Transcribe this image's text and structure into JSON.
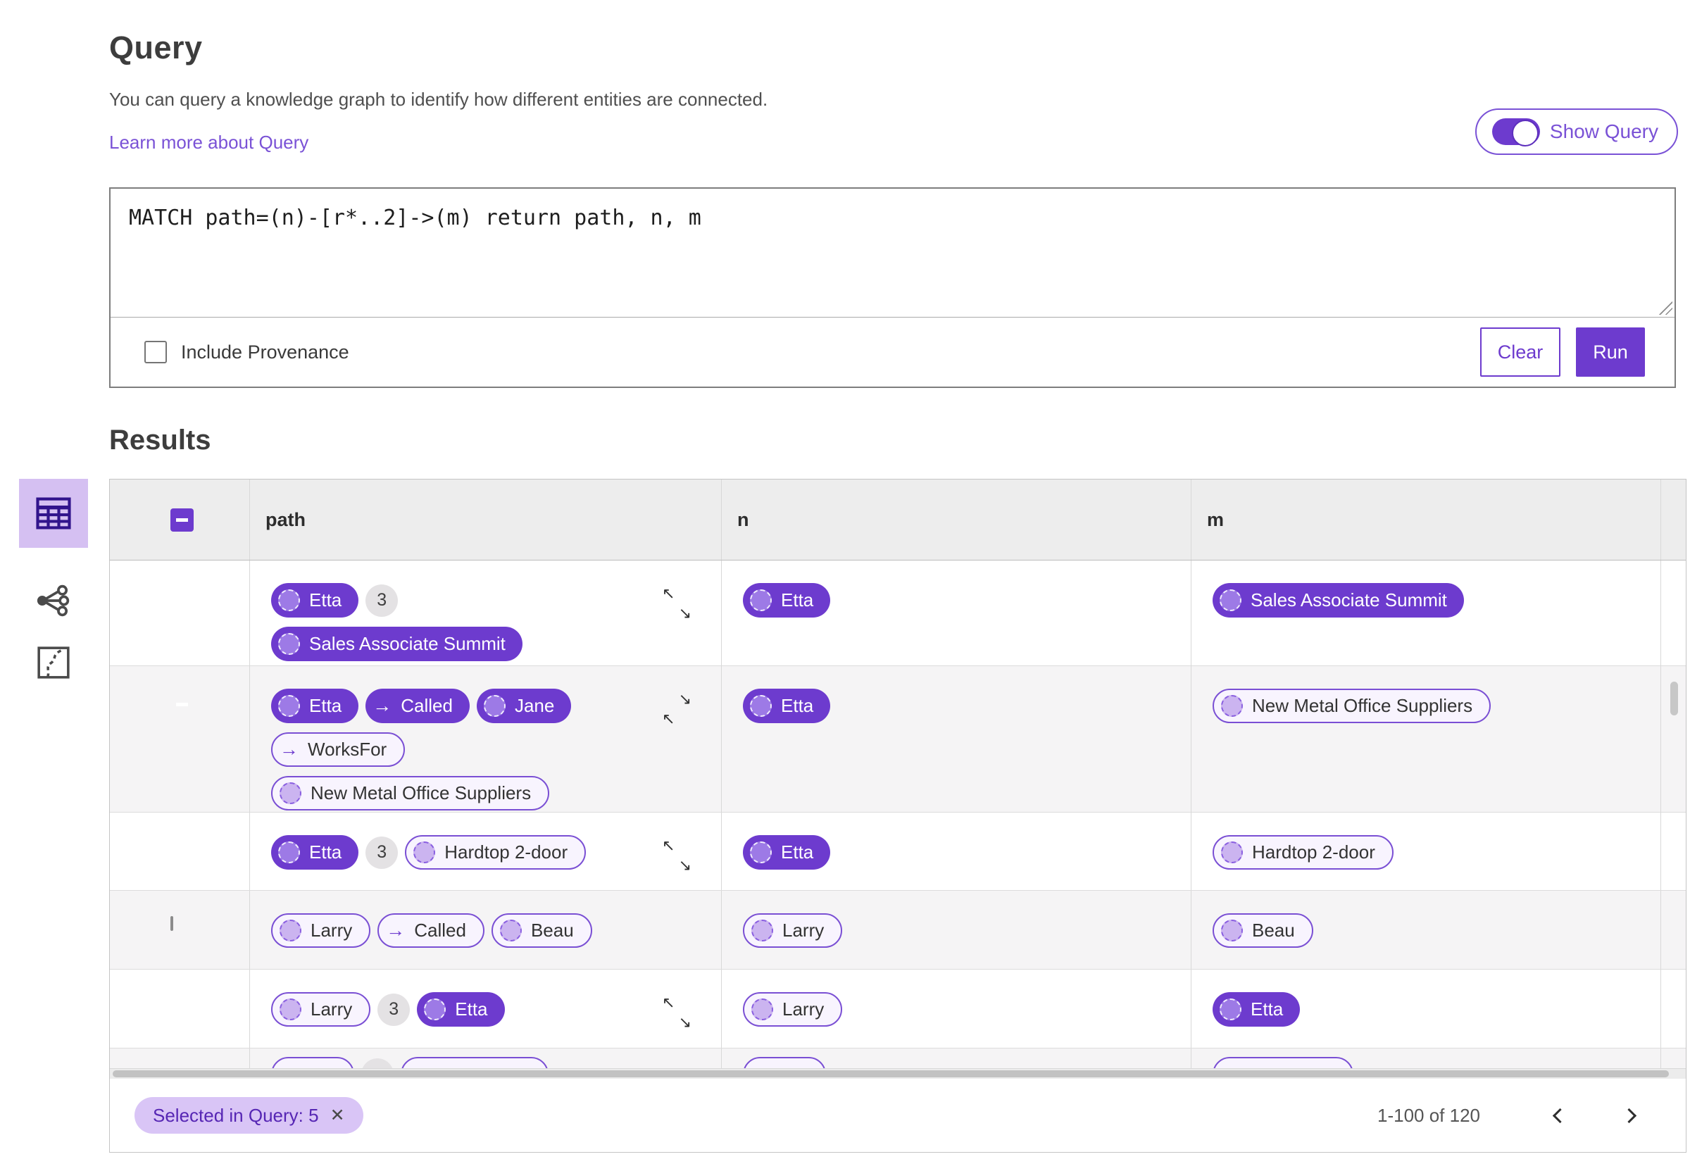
{
  "colors": {
    "primary_purple": "#6d3bce",
    "link_purple": "#7a52d6",
    "selected_view_bg": "#d5c0f2",
    "chip_bg": "#d9c5f6",
    "outlined_pill_border": "#7a4fd4",
    "table_header_bg": "#ededed",
    "zebra_row_bg": "#f5f4f5"
  },
  "icons": {
    "arrow_right": "→",
    "expand_nw": "↖",
    "expand_se": "↘",
    "close": "✕"
  },
  "header": {
    "title": "Query",
    "description": "You can query a knowledge graph to identify how different entities are connected.",
    "learn_more_link": "Learn more about Query",
    "show_query_label": "Show Query",
    "show_query_on": true
  },
  "query_editor": {
    "query_text": "MATCH path=(n)-[r*..2]->(m) return path, n, m",
    "include_provenance_label": "Include Provenance",
    "include_provenance_checked": false,
    "clear_label": "Clear",
    "run_label": "Run"
  },
  "results": {
    "title": "Results",
    "views": [
      {
        "name": "table-view",
        "selected": true
      },
      {
        "name": "graph-view",
        "selected": false
      },
      {
        "name": "map-view",
        "selected": false
      }
    ],
    "table": {
      "columns": [
        "path",
        "n",
        "m"
      ],
      "select_all_state": "indeterminate",
      "rows": [
        {
          "checkbox": "checked",
          "expander": "expand",
          "path": [
            [
              {
                "kind": "node-filled",
                "label": "Etta"
              },
              {
                "kind": "count-badge",
                "label": "3"
              }
            ],
            [
              {
                "kind": "node-filled",
                "label": "Sales Associate Summit"
              }
            ]
          ],
          "n": [
            {
              "kind": "node-filled",
              "label": "Etta"
            }
          ],
          "m": [
            {
              "kind": "node-filled",
              "label": "Sales Associate Summit"
            }
          ]
        },
        {
          "checkbox": "indeterminate",
          "expander": "collapse",
          "path": [
            [
              {
                "kind": "node-filled",
                "label": "Etta"
              },
              {
                "kind": "edge-filled",
                "label": "Called"
              },
              {
                "kind": "node-filled",
                "label": "Jane"
              }
            ],
            [
              {
                "kind": "edge-outlined",
                "label": "WorksFor"
              }
            ],
            [
              {
                "kind": "node-outlined",
                "label": "New Metal Office Suppliers"
              }
            ]
          ],
          "n": [
            {
              "kind": "node-filled",
              "label": "Etta"
            }
          ],
          "m": [
            {
              "kind": "node-outlined",
              "label": "New Metal Office Suppliers"
            }
          ]
        },
        {
          "checkbox": "indeterminate",
          "expander": "expand",
          "path": [
            [
              {
                "kind": "node-filled",
                "label": "Etta"
              },
              {
                "kind": "count-badge",
                "label": "3"
              },
              {
                "kind": "node-outlined",
                "label": "Hardtop 2-door"
              }
            ]
          ],
          "n": [
            {
              "kind": "node-filled",
              "label": "Etta"
            }
          ],
          "m": [
            {
              "kind": "node-outlined",
              "label": "Hardtop 2-door"
            }
          ]
        },
        {
          "checkbox": "unchecked",
          "expander": null,
          "path": [
            [
              {
                "kind": "node-outlined",
                "label": "Larry"
              },
              {
                "kind": "edge-outlined",
                "label": "Called"
              },
              {
                "kind": "node-outlined",
                "label": "Beau"
              }
            ]
          ],
          "n": [
            {
              "kind": "node-outlined",
              "label": "Larry"
            }
          ],
          "m": [
            {
              "kind": "node-outlined",
              "label": "Beau"
            }
          ]
        },
        {
          "checkbox": "indeterminate",
          "expander": "expand",
          "path": [
            [
              {
                "kind": "node-outlined",
                "label": "Larry"
              },
              {
                "kind": "count-badge",
                "label": "3"
              },
              {
                "kind": "node-filled",
                "label": "Etta"
              }
            ]
          ],
          "n": [
            {
              "kind": "node-outlined",
              "label": "Larry"
            }
          ],
          "m": [
            {
              "kind": "node-filled",
              "label": "Etta"
            }
          ]
        }
      ],
      "partial_row": {
        "path_widths": [
          118,
          46,
          210
        ],
        "n_widths": [
          118
        ],
        "m_widths": [
          200
        ]
      }
    },
    "footer": {
      "selected_chip": "Selected in Query: 5",
      "page_range": "1-100 of 120"
    }
  }
}
